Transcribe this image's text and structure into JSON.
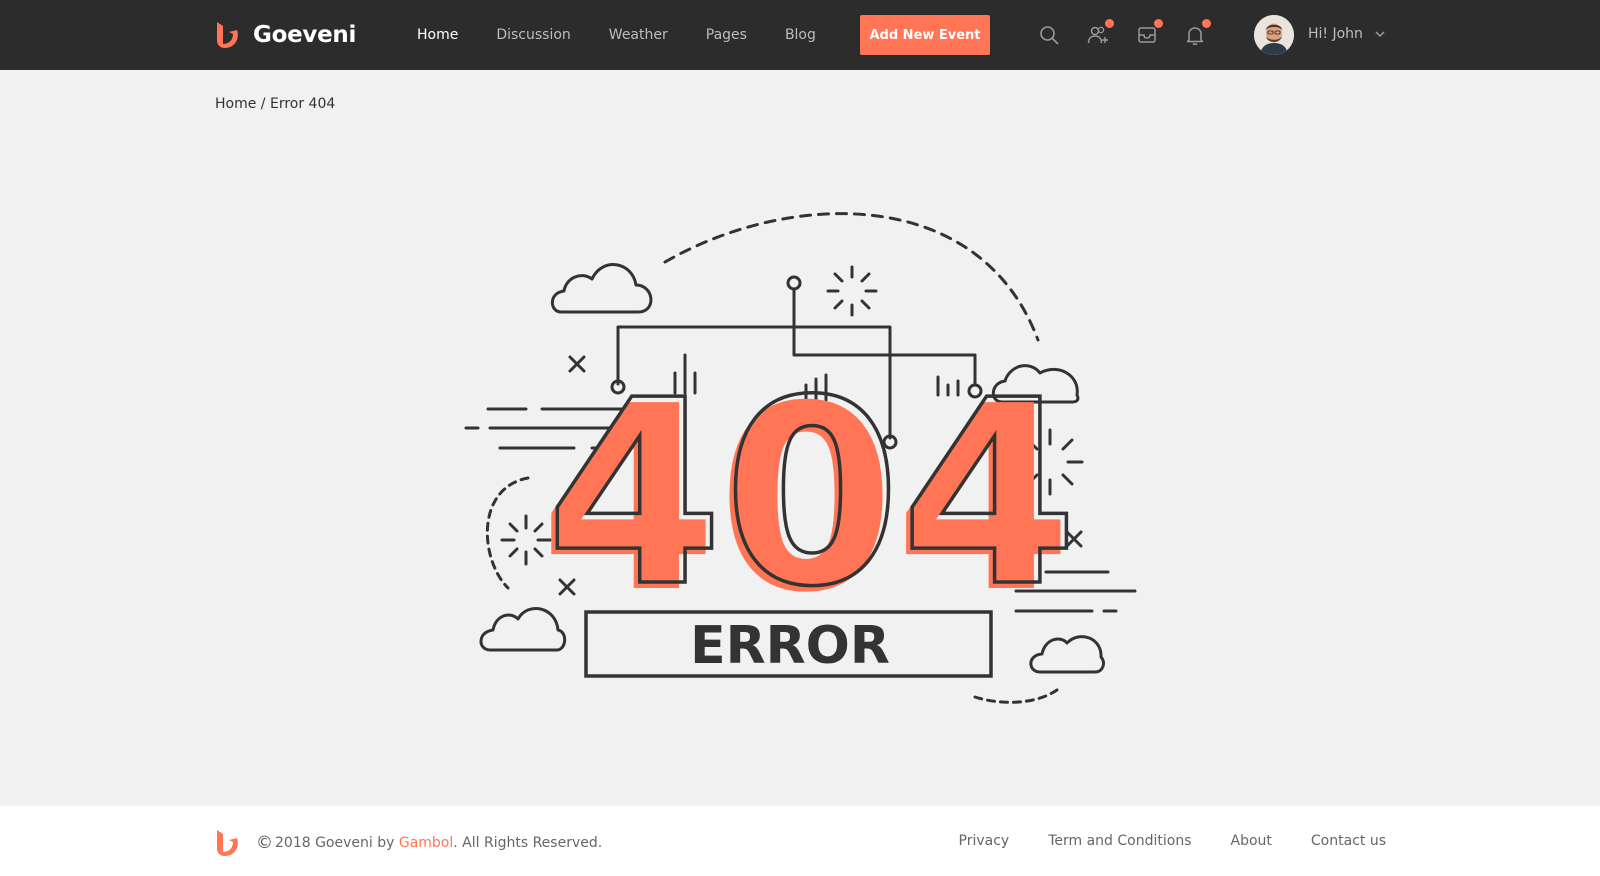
{
  "header": {
    "brand": "Goeveni",
    "nav": [
      {
        "label": "Home",
        "active": true
      },
      {
        "label": "Discussion",
        "active": false
      },
      {
        "label": "Weather",
        "active": false
      },
      {
        "label": "Pages",
        "active": false
      },
      {
        "label": "Blog",
        "active": false
      }
    ],
    "add_button": "Add New Event",
    "icons": [
      "search-icon",
      "friends-icon",
      "messages-icon",
      "notifications-icon"
    ],
    "user_greeting": "Hi! John"
  },
  "breadcrumb": {
    "home": "Home",
    "separator": "/",
    "current": "Error 404"
  },
  "error": {
    "code": "404",
    "label": "ERROR"
  },
  "footer": {
    "copyright_symbol": "©",
    "copyright_prefix": "2018 Goeveni by",
    "copyright_brand": "Gambol",
    "copyright_suffix": ". All Rights Reserved.",
    "links": [
      "Privacy",
      "Term and Conditions",
      "About",
      "Contact us"
    ]
  },
  "colors": {
    "accent": "#ff7555",
    "header_bg": "#2c2c2c",
    "page_bg": "#f1f1f1",
    "line": "#333333"
  }
}
